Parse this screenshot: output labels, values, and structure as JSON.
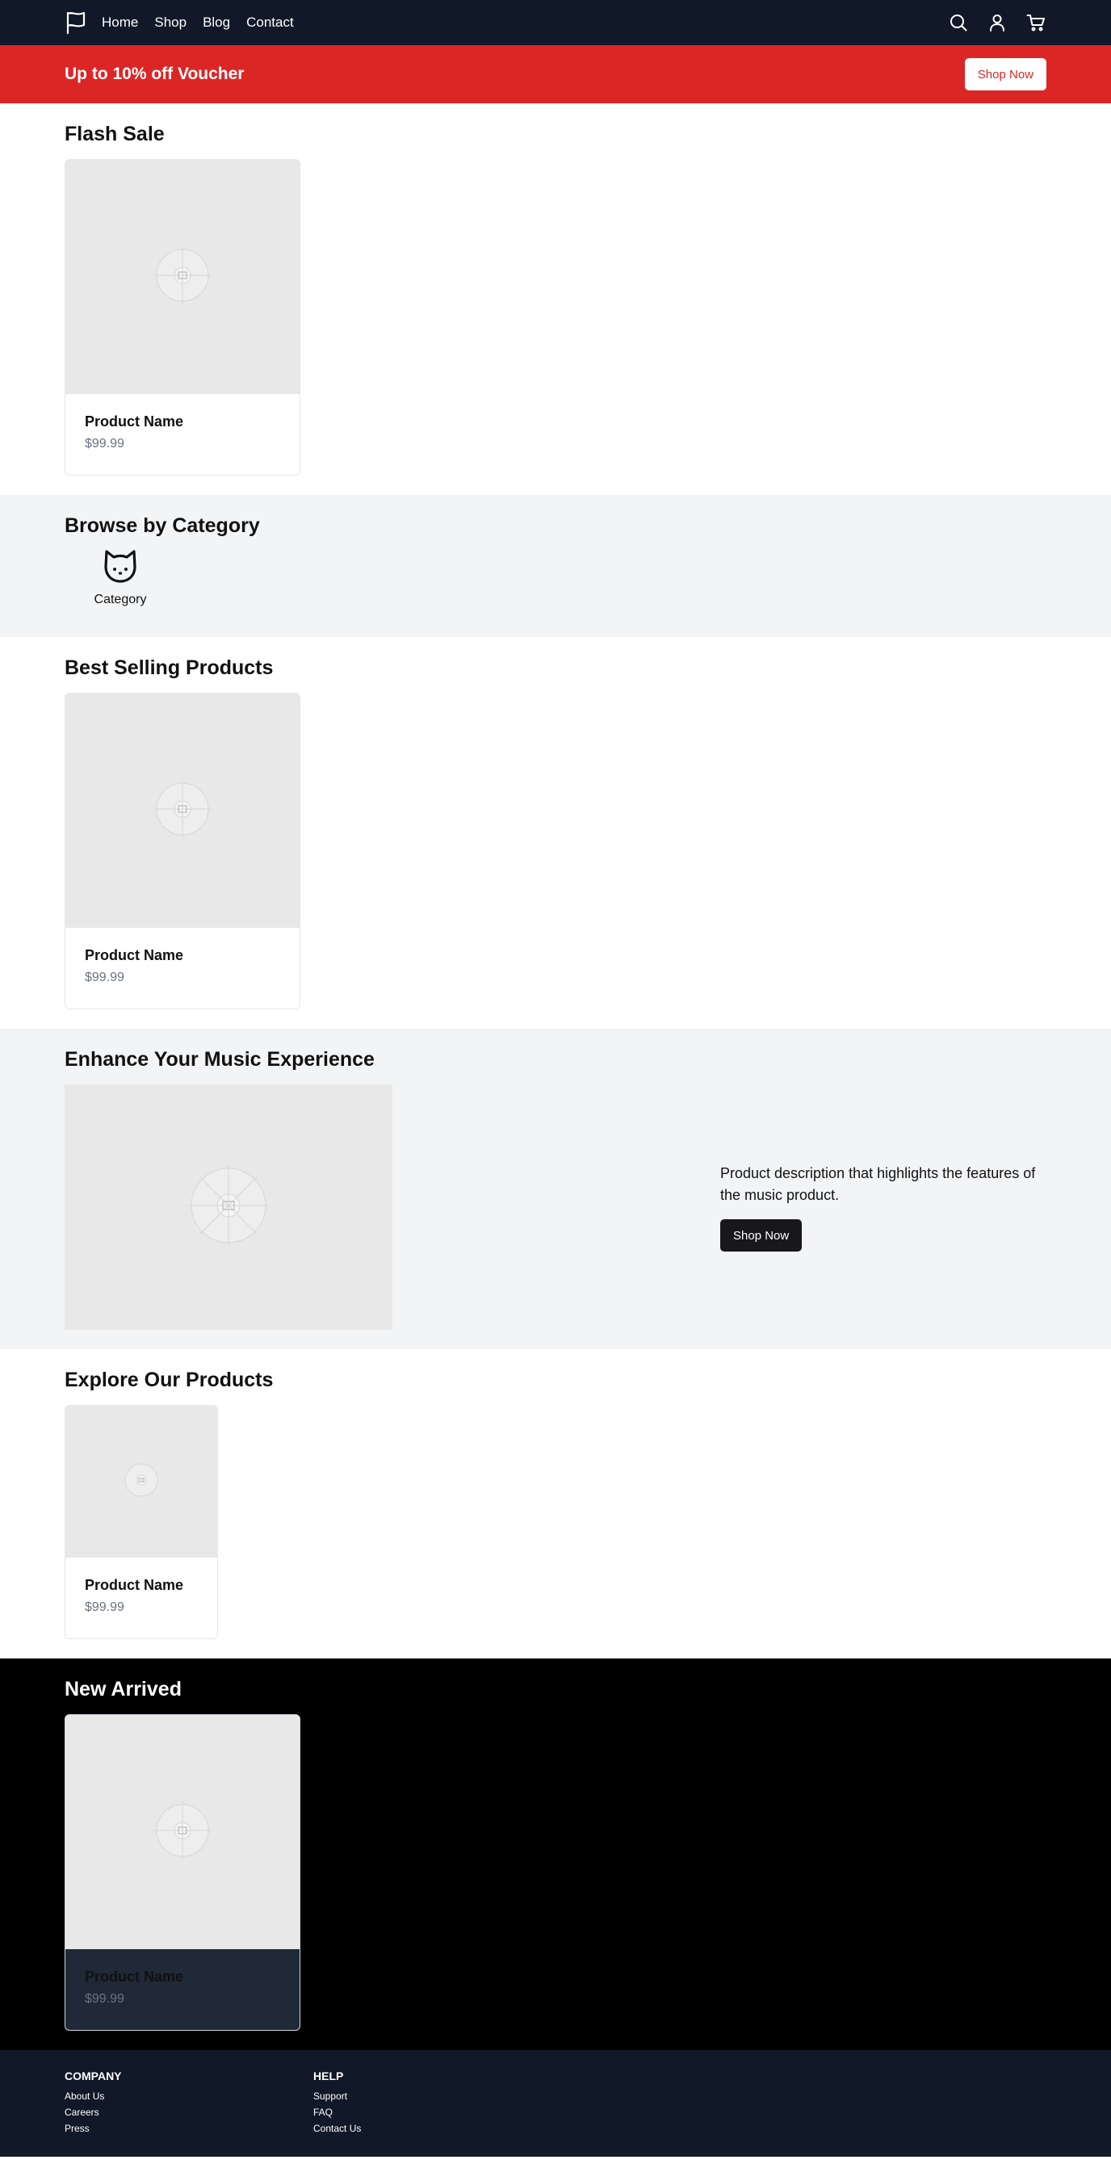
{
  "nav": {
    "logo_icon": "flag-icon",
    "links": [
      "Home",
      "Shop",
      "Blog",
      "Contact"
    ],
    "icons": [
      "search-icon",
      "user-icon",
      "cart-icon"
    ]
  },
  "promo": {
    "text": "Up to 10% off Voucher",
    "button": "Shop Now"
  },
  "flash_sale": {
    "title": "Flash Sale",
    "product": {
      "name": "Product Name",
      "price": "$99.99",
      "image_icon": "image-placeholder-icon"
    }
  },
  "categories": {
    "title": "Browse by Category",
    "items": [
      {
        "label": "Category",
        "icon": "cat-icon"
      }
    ]
  },
  "best_selling": {
    "title": "Best Selling Products",
    "product": {
      "name": "Product Name",
      "price": "$99.99"
    }
  },
  "feature": {
    "title": "Enhance Your Music Experience",
    "description": "Product description that highlights the features of the music product.",
    "button": "Shop Now"
  },
  "explore": {
    "title": "Explore Our Products",
    "product": {
      "name": "Product Name",
      "price": "$99.99"
    }
  },
  "new_arrived": {
    "title": "New Arrived",
    "product": {
      "name": "Product Name",
      "price": "$99.99"
    }
  },
  "footer": {
    "columns": [
      {
        "heading": "COMPANY",
        "links": [
          "About Us",
          "Careers",
          "Press"
        ]
      },
      {
        "heading": "HELP",
        "links": [
          "Support",
          "FAQ",
          "Contact Us"
        ]
      }
    ]
  },
  "colors": {
    "nav_bg": "#111827",
    "promo_bg": "#dc2626",
    "section_gray": "#f3f4f6",
    "dark_button": "#18181b"
  }
}
